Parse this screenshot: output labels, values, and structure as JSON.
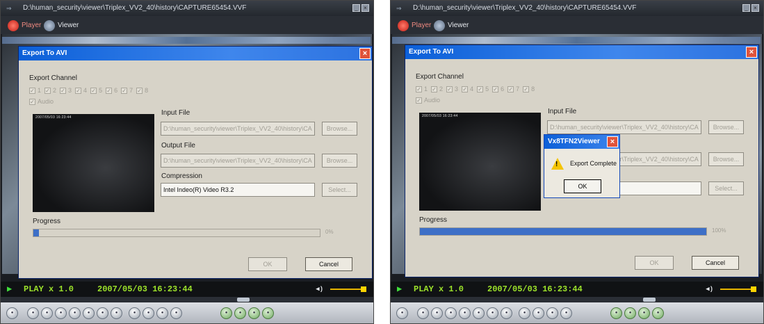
{
  "app": {
    "title": "D:\\human_security\\viewer\\Triplex_VV2_40\\history\\CAPTURE65454.VVF",
    "tabs": [
      "Player",
      "Viewer"
    ]
  },
  "dialog": {
    "title": "Export To AVI",
    "export_channel_label": "Export Channel",
    "channels": [
      "1",
      "2",
      "3",
      "4",
      "5",
      "6",
      "7",
      "8"
    ],
    "audio_label": "Audio",
    "preview_timestamp": "2007/05/03 16:23:44",
    "input_file_label": "Input File",
    "input_file_value": "D:\\human_security\\viewer\\Triplex_VV2_40\\history\\CA",
    "output_file_label": "Output File",
    "output_file_value": "D:\\human_security\\viewer\\Triplex_VV2_40\\history\\CA",
    "compression_label": "Compression",
    "compression_value": "Intel Indeo(R) Video R3.2",
    "browse_label": "Browse...",
    "select_label": "Select...",
    "progress_label": "Progress",
    "ok_label": "OK",
    "cancel_label": "Cancel"
  },
  "left": {
    "progress_text": "0%",
    "progress_value": 0.02
  },
  "right": {
    "progress_text": "100%",
    "progress_value": 1.0,
    "message_box": {
      "title": "Vx8TFN2Viewer",
      "text": "Export Complete",
      "ok_label": "OK"
    }
  },
  "playbar": {
    "state": "PLAY  x 1.0",
    "timestamp": "2007/05/03 16:23:44"
  },
  "colors": {
    "dialog_title": "#2c72e0",
    "progress_fill": "#3d6fc7",
    "play_text": "#9ce22a"
  }
}
